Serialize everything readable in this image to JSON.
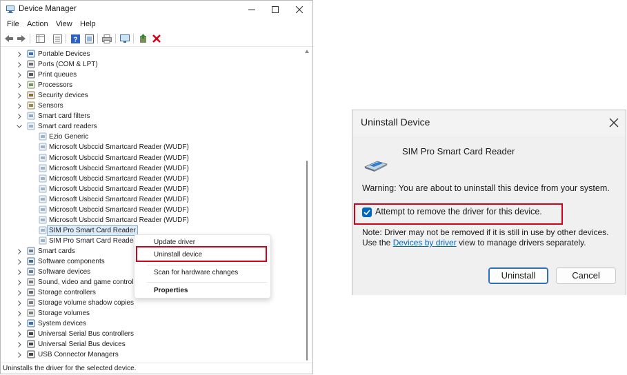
{
  "device_manager": {
    "title": "Device Manager",
    "menu": [
      "File",
      "Action",
      "View",
      "Help"
    ],
    "tree": [
      {
        "label": "Portable Devices",
        "icon": "portable-device-icon",
        "chevron": "right"
      },
      {
        "label": "Ports (COM & LPT)",
        "icon": "port-icon",
        "chevron": "right"
      },
      {
        "label": "Print queues",
        "icon": "printer-icon",
        "chevron": "right"
      },
      {
        "label": "Processors",
        "icon": "processor-icon",
        "chevron": "right"
      },
      {
        "label": "Security devices",
        "icon": "security-device-icon",
        "chevron": "right"
      },
      {
        "label": "Sensors",
        "icon": "sensor-icon",
        "chevron": "right"
      },
      {
        "label": "Smart card filters",
        "icon": "smart-card-filter-icon",
        "chevron": "right"
      },
      {
        "label": "Smart card readers",
        "icon": "smart-card-reader-icon",
        "chevron": "down"
      },
      {
        "label": "Ezio Generic",
        "icon": "smart-card-reader-icon",
        "child": true
      },
      {
        "label": "Microsoft Usbccid Smartcard Reader (WUDF)",
        "icon": "smart-card-reader-icon",
        "child": true
      },
      {
        "label": "Microsoft Usbccid Smartcard Reader (WUDF)",
        "icon": "smart-card-reader-icon",
        "child": true
      },
      {
        "label": "Microsoft Usbccid Smartcard Reader (WUDF)",
        "icon": "smart-card-reader-icon",
        "child": true
      },
      {
        "label": "Microsoft Usbccid Smartcard Reader (WUDF)",
        "icon": "smart-card-reader-icon",
        "child": true
      },
      {
        "label": "Microsoft Usbccid Smartcard Reader (WUDF)",
        "icon": "smart-card-reader-icon",
        "child": true
      },
      {
        "label": "Microsoft Usbccid Smartcard Reader (WUDF)",
        "icon": "smart-card-reader-icon",
        "child": true
      },
      {
        "label": "Microsoft Usbccid Smartcard Reader (WUDF)",
        "icon": "smart-card-reader-icon",
        "child": true
      },
      {
        "label": "Microsoft Usbccid Smartcard Reader (WUDF)",
        "icon": "smart-card-reader-icon",
        "child": true
      },
      {
        "label": "SIM Pro Smart Card Reader",
        "icon": "smart-card-reader-icon",
        "child": true,
        "selected": true
      },
      {
        "label": "SIM Pro Smart Card Reader",
        "icon": "smart-card-reader-icon",
        "child": true
      },
      {
        "label": "Smart cards",
        "icon": "smart-card-icon",
        "chevron": "right"
      },
      {
        "label": "Software components",
        "icon": "software-component-icon",
        "chevron": "right"
      },
      {
        "label": "Software devices",
        "icon": "software-device-icon",
        "chevron": "right"
      },
      {
        "label": "Sound, video and game controllers",
        "icon": "speaker-icon",
        "chevron": "right"
      },
      {
        "label": "Storage controllers",
        "icon": "storage-controller-icon",
        "chevron": "right"
      },
      {
        "label": "Storage volume shadow copies",
        "icon": "storage-icon",
        "chevron": "right"
      },
      {
        "label": "Storage volumes",
        "icon": "storage-icon",
        "chevron": "right"
      },
      {
        "label": "System devices",
        "icon": "system-device-icon",
        "chevron": "right"
      },
      {
        "label": "Universal Serial Bus controllers",
        "icon": "usb-icon",
        "chevron": "right"
      },
      {
        "label": "Universal Serial Bus devices",
        "icon": "usb-icon",
        "chevron": "right"
      },
      {
        "label": "USB Connector Managers",
        "icon": "usb-icon",
        "chevron": "right"
      }
    ],
    "context_menu": {
      "update_driver": "Update driver",
      "uninstall_device": "Uninstall device",
      "scan_hardware": "Scan for hardware changes",
      "properties": "Properties"
    },
    "status_text": "Uninstalls the driver for the selected device."
  },
  "uninstall_dialog": {
    "title": "Uninstall Device",
    "device_name": "SIM Pro Smart Card Reader",
    "warning": "Warning: You are about to uninstall this device from your system.",
    "checkbox_label": "Attempt to remove the driver for this device.",
    "checkbox_checked": true,
    "note_part1": "Note: Driver may not be removed if it is still in use by other devices. Use the ",
    "note_link": "Devices by driver",
    "note_part2": " view to manage drivers separately.",
    "uninstall_button": "Uninstall",
    "cancel_button": "Cancel"
  },
  "colors": {
    "highlight_border": "#d0021b",
    "accent": "#0067c0",
    "selection_bg": "#dcebf7"
  }
}
